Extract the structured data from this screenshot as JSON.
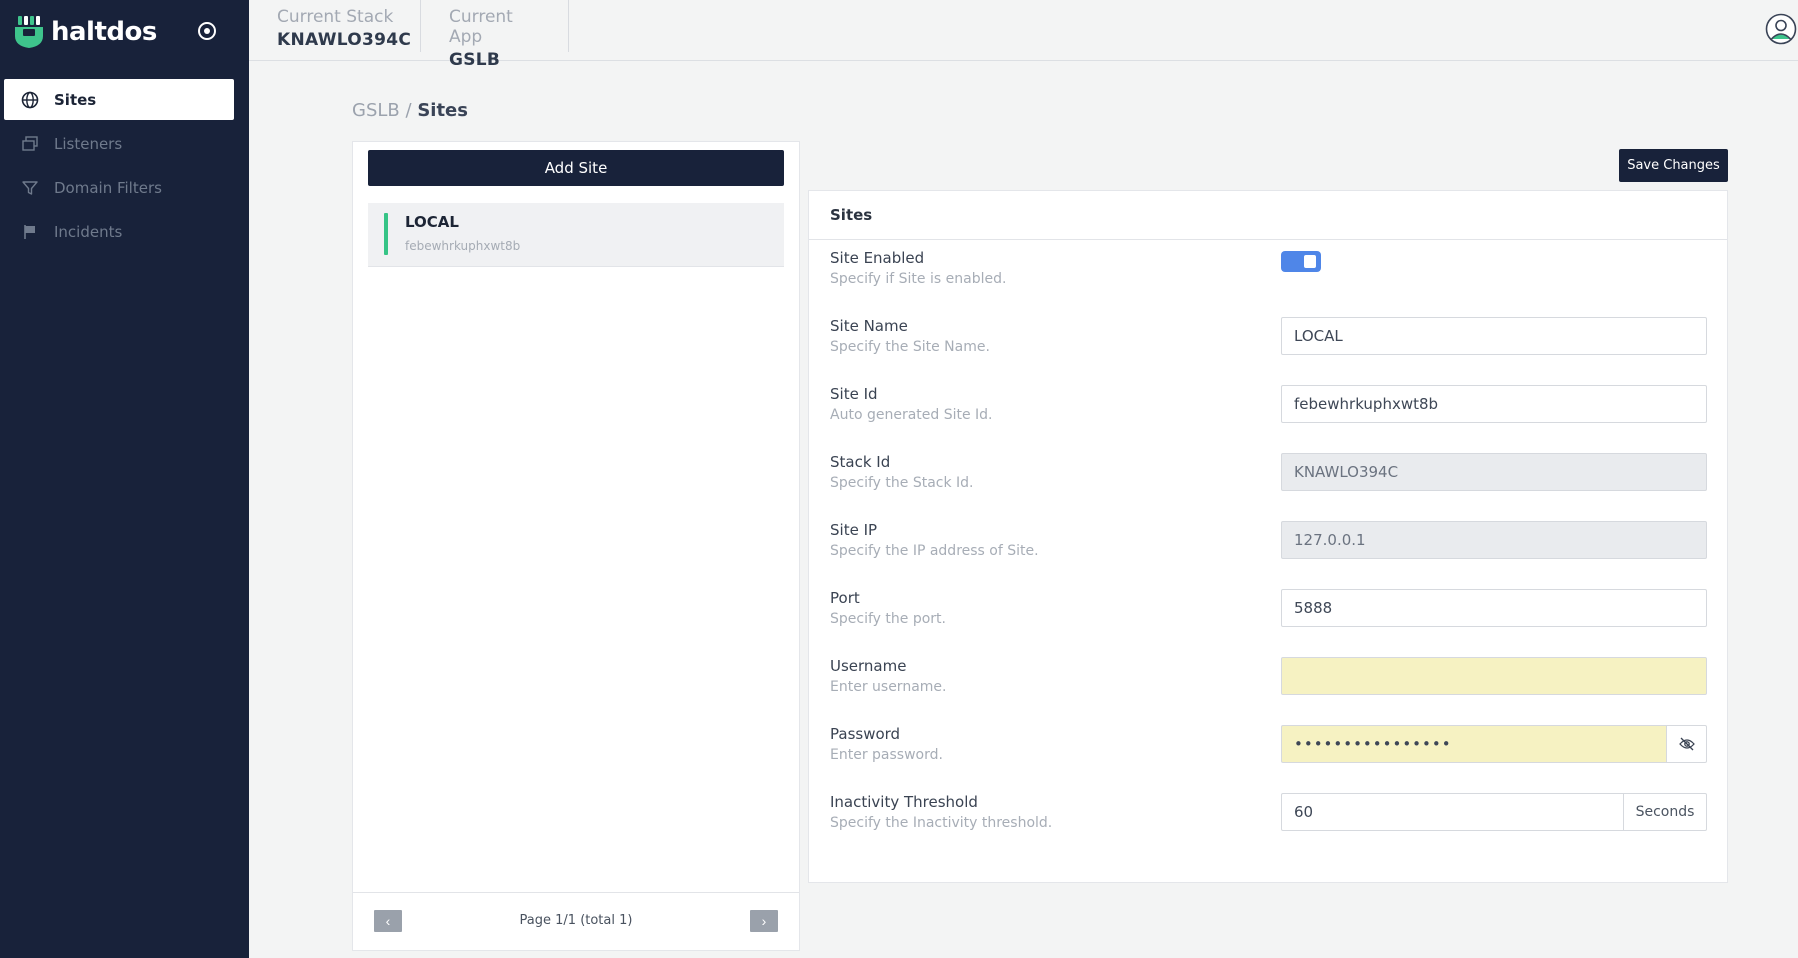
{
  "brand": {
    "name": "haltdos",
    "logo_color": "#3ec48c"
  },
  "sidebar": {
    "items": [
      {
        "label": "Sites",
        "icon": "globe-icon",
        "active": true
      },
      {
        "label": "Listeners",
        "icon": "windows-icon",
        "active": false
      },
      {
        "label": "Domain Filters",
        "icon": "filter-icon",
        "active": false
      },
      {
        "label": "Incidents",
        "icon": "flag-icon",
        "active": false
      }
    ]
  },
  "topbar": {
    "stack_label": "Current Stack",
    "stack_value": "KNAWLO394C",
    "app_label": "Current App",
    "app_value": "GSLB"
  },
  "breadcrumb": {
    "parent": "GSLB",
    "separator": "/",
    "current": "Sites"
  },
  "site_list": {
    "add_label": "Add Site",
    "items": [
      {
        "name": "LOCAL",
        "id": "febewhrkuphxwt8b",
        "status_color": "#36c486"
      }
    ],
    "pager": {
      "prev": "‹",
      "next": "›",
      "text": "Page 1/1 (total 1)"
    }
  },
  "save_label": "Save Changes",
  "form": {
    "title": "Sites",
    "site_enabled": {
      "label": "Site Enabled",
      "help": "Specify if Site is enabled.",
      "on": true
    },
    "site_name": {
      "label": "Site Name",
      "help": "Specify the Site Name.",
      "value": "LOCAL"
    },
    "site_id": {
      "label": "Site Id",
      "help": "Auto generated Site Id.",
      "value": "febewhrkuphxwt8b"
    },
    "stack_id": {
      "label": "Stack Id",
      "help": "Specify the Stack Id.",
      "value": "KNAWLO394C"
    },
    "site_ip": {
      "label": "Site IP",
      "help": "Specify the IP address of Site.",
      "value": "127.0.0.1"
    },
    "port": {
      "label": "Port",
      "help": "Specify the port.",
      "value": "5888"
    },
    "username": {
      "label": "Username",
      "help": "Enter username.",
      "value": ""
    },
    "password": {
      "label": "Password",
      "help": "Enter password.",
      "value": "••••••••••••••••"
    },
    "inactivity": {
      "label": "Inactivity Threshold",
      "help": "Specify the Inactivity threshold.",
      "value": "60",
      "unit": "Seconds"
    }
  }
}
